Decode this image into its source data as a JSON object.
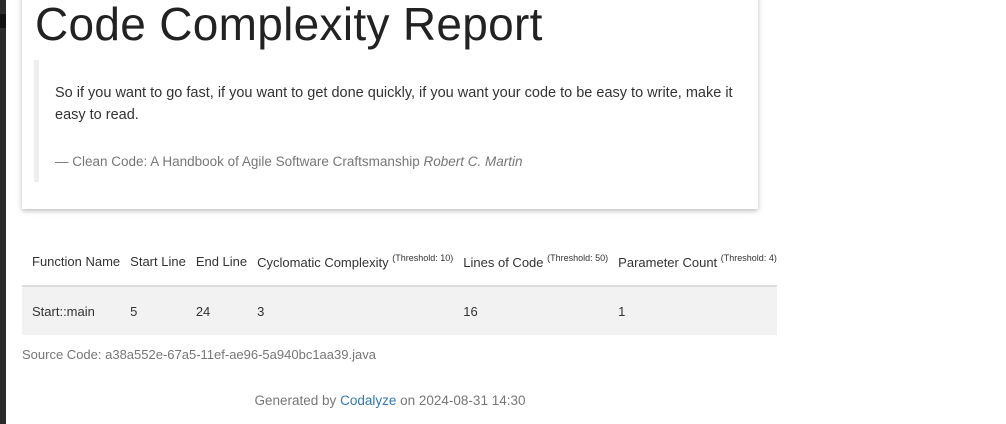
{
  "header": {
    "title": "Code Complexity Report"
  },
  "quote": {
    "text": "So if you want to go fast, if you want to get done quickly, if you want your code to be easy to write, make it easy to read.",
    "cite_prefix": "— Clean Code: A Handbook of Agile Software Craftsmanship",
    "author": "Robert C. Martin"
  },
  "table": {
    "columns": [
      {
        "label": "Function Name",
        "threshold": ""
      },
      {
        "label": "Start Line",
        "threshold": ""
      },
      {
        "label": "End Line",
        "threshold": ""
      },
      {
        "label": "Cyclomatic Complexity",
        "threshold": "(Threshold: 10)"
      },
      {
        "label": "Lines of Code",
        "threshold": "(Threshold: 50)"
      },
      {
        "label": "Parameter Count",
        "threshold": "(Threshold: 4)"
      }
    ],
    "rows": [
      [
        "Start::main",
        "5",
        "24",
        "3",
        "16",
        "1"
      ]
    ]
  },
  "source": {
    "text": "Source Code: a38a552e-67a5-11ef-ae96-5a940bc1aa39.java"
  },
  "footer": {
    "prefix": "Generated by",
    "link": "Codalyze",
    "suffix": "on 2024-08-31 14:30"
  },
  "colors": {
    "link": "#337ab7",
    "row_background": "#f2f2f2",
    "muted_text": "#777777"
  }
}
